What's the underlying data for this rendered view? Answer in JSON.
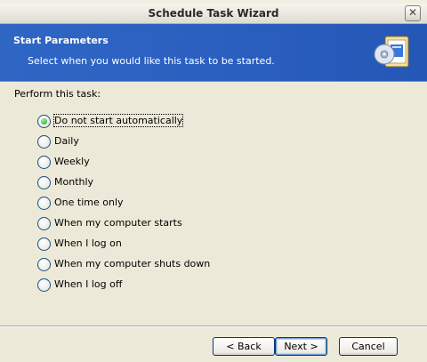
{
  "dialog": {
    "title": "Schedule Task Wizard",
    "close_label": "✕"
  },
  "header": {
    "title": "Start Parameters",
    "subtitle": "Select when you would like this task to be started."
  },
  "prompt": "Perform this task:",
  "options": [
    {
      "label": "Do not start automatically",
      "checked": true
    },
    {
      "label": "Daily",
      "checked": false
    },
    {
      "label": "Weekly",
      "checked": false
    },
    {
      "label": "Monthly",
      "checked": false
    },
    {
      "label": "One time only",
      "checked": false
    },
    {
      "label": "When my computer starts",
      "checked": false
    },
    {
      "label": "When I log on",
      "checked": false
    },
    {
      "label": "When my computer shuts down",
      "checked": false
    },
    {
      "label": "When I log off",
      "checked": false
    }
  ],
  "buttons": {
    "back": "< Back",
    "next": "Next >",
    "cancel": "Cancel"
  },
  "colors": {
    "header_blue": "#2b5fbf",
    "dialog_bg": "#ece9d8",
    "button_border": "#003c74"
  }
}
